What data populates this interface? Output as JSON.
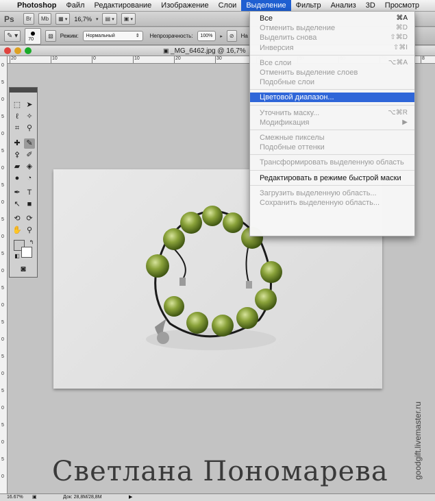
{
  "menubar": {
    "apple": "",
    "items": [
      "Photoshop",
      "Файл",
      "Редактирование",
      "Изображение",
      "Слои",
      "Выделение",
      "Фильтр",
      "Анализ",
      "3D",
      "Просмотр"
    ],
    "active_index": 5
  },
  "appbar": {
    "ps_label": "Ps",
    "br_label": "Br",
    "mb_label": "Mb",
    "zoom": "16,7%"
  },
  "options": {
    "brush_size": "70",
    "mode_label": "Режим:",
    "mode_value": "Нормальный",
    "opacity_label": "Непрозрачность:",
    "opacity_value": "100%",
    "extra_label": "На"
  },
  "document": {
    "title": "_MG_6462.jpg @ 16,7%"
  },
  "rulers": {
    "h_ticks": [
      "20",
      "10",
      "0",
      "10",
      "20",
      "30",
      "40",
      "50",
      "60",
      "70",
      "8"
    ],
    "v_ticks": [
      "0",
      "5",
      "0",
      "5",
      "0",
      "5",
      "0",
      "5",
      "0",
      "5",
      "0",
      "5",
      "0",
      "5",
      "0",
      "5",
      "0",
      "5",
      "0",
      "5",
      "0",
      "5",
      "0",
      "5",
      "0"
    ]
  },
  "menu": {
    "groups": [
      [
        {
          "label": "Все",
          "shortcut": "⌘A",
          "enabled": true
        },
        {
          "label": "Отменить выделение",
          "shortcut": "⌘D",
          "enabled": false
        },
        {
          "label": "Выделить снова",
          "shortcut": "⇧⌘D",
          "enabled": false
        },
        {
          "label": "Инверсия",
          "shortcut": "⇧⌘I",
          "enabled": false
        }
      ],
      [
        {
          "label": "Все слои",
          "shortcut": "⌥⌘A",
          "enabled": false
        },
        {
          "label": "Отменить выделение слоев",
          "shortcut": "",
          "enabled": false
        },
        {
          "label": "Подобные слои",
          "shortcut": "",
          "enabled": false
        }
      ],
      [
        {
          "label": "Цветовой диапазон...",
          "shortcut": "",
          "enabled": true,
          "highlighted": true
        }
      ],
      [
        {
          "label": "Уточнить маску...",
          "shortcut": "⌥⌘R",
          "enabled": false
        },
        {
          "label": "Модификация",
          "shortcut": "▶",
          "enabled": false
        }
      ],
      [
        {
          "label": "Смежные пикселы",
          "shortcut": "",
          "enabled": false
        },
        {
          "label": "Подобные оттенки",
          "shortcut": "",
          "enabled": false
        }
      ],
      [
        {
          "label": "Трансформировать выделенную область",
          "shortcut": "",
          "enabled": false
        }
      ],
      [
        {
          "label": "Редактировать в режиме быстрой маски",
          "shortcut": "",
          "enabled": true
        }
      ],
      [
        {
          "label": "Загрузить выделенную область...",
          "shortcut": "",
          "enabled": false
        },
        {
          "label": "Сохранить выделенную область...",
          "shortcut": "",
          "enabled": false
        }
      ]
    ]
  },
  "status": {
    "zoom": "16.67%",
    "doc": "Док: 28,8M/28,8M"
  },
  "watermark": {
    "name": "Светлана Пономарева",
    "url": "goodgift.livemaster.ru"
  },
  "colors": {
    "menu_highlight": "#2f66d8",
    "bead_green": "#8aa23a",
    "canvas_bg": "#c3c3c3"
  }
}
